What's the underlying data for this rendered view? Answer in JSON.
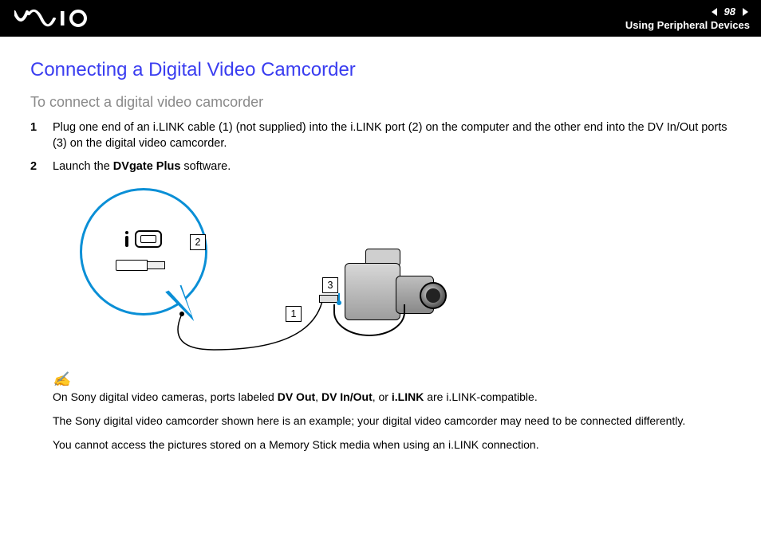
{
  "header": {
    "page_number": "98",
    "section": "Using Peripheral Devices"
  },
  "main": {
    "title": "Connecting a Digital Video Camcorder",
    "subtitle": "To connect a digital video camcorder",
    "step1_num": "1",
    "step1_text": "Plug one end of an i.LINK cable (1) (not supplied) into the i.LINK port (2) on the computer and the other end into the DV In/Out ports (3) on the digital video camcorder.",
    "step2_num": "2",
    "step2_prefix": "Launch the ",
    "step2_bold": "DVgate Plus",
    "step2_suffix": " software."
  },
  "diagram": {
    "callout1": "1",
    "callout2": "2",
    "callout3": "3"
  },
  "notes": {
    "line1_a": "On Sony digital video cameras, ports labeled ",
    "b1": "DV Out",
    "sep1": ", ",
    "b2": "DV In/Out",
    "sep2": ", or ",
    "b3": "i.LINK",
    "line1_b": " are i.LINK-compatible.",
    "line2": "The Sony digital video camcorder shown here is an example; your digital video camcorder may need to be connected differently.",
    "line3": "You cannot access the pictures stored on a Memory Stick media when using an i.LINK connection."
  }
}
